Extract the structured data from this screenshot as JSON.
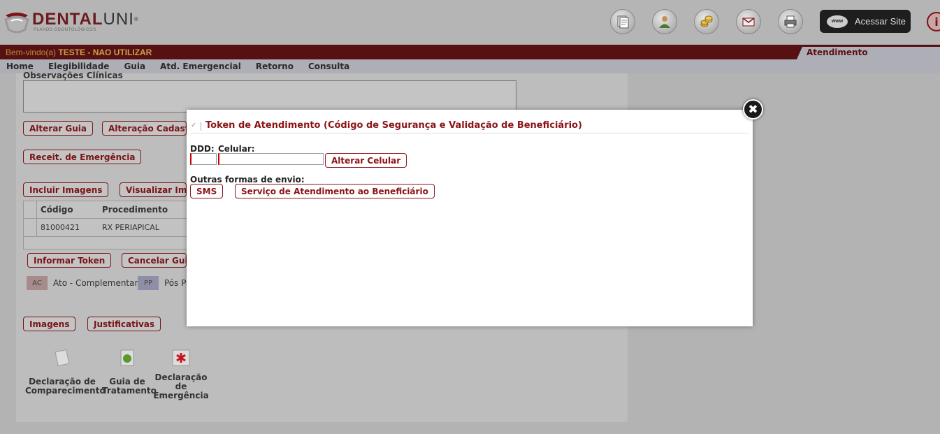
{
  "header": {
    "logo_main": "DENTAL",
    "logo_accent": "UNI",
    "logo_reg": "®",
    "logo_sub": "PLANOS ODONTOLÓGICOS",
    "icons": [
      "documents-icon",
      "user-icon",
      "coins-icon",
      "mail-icon",
      "printer-icon"
    ],
    "www_badge": "www",
    "acessar_site": "Acessar Site",
    "info_glyph": "i"
  },
  "welcome": {
    "prefix": "Bem-vindo(a) ",
    "user": "TESTE - NAO UTILIZAR",
    "section": "Atendimento"
  },
  "menu": {
    "items": [
      "Home",
      "Elegibilidade",
      "Guia",
      "Atd. Emergencial",
      "Retorno",
      "Consulta"
    ]
  },
  "background": {
    "obs_label": "Observações Clínicas",
    "buttons": {
      "alterar_guia": "Alterar Guia",
      "alteracao_cadastral": "Alteração Cadastral",
      "receit_emergencia": "Receit. de Emergência",
      "incluir_imagens": "Incluir Imagens",
      "visualizar_imagens": "Visualizar Imagens",
      "informar_token": "Informar Token",
      "cancelar_guia": "Cancelar Guia",
      "imagens": "Imagens",
      "justificativas": "Justificativas"
    },
    "table": {
      "headers": [
        "Código",
        "Procedimento"
      ],
      "rows": [
        [
          "81000421",
          "RX PERIAPICAL"
        ]
      ]
    },
    "legend": [
      {
        "code": "AC",
        "label": "Ato - Complementar",
        "color": "#a78a8a"
      },
      {
        "code": "PP",
        "label": "Pós Pa",
        "color": "#8e8ea6"
      }
    ],
    "docs": {
      "declaracao_comparecimento": [
        "Declaração de",
        "Comparecimento"
      ],
      "guia_tratamento": [
        "Guia de",
        "Tratamento"
      ],
      "declaracao_emergencia": [
        "Declaração",
        "de",
        "Emergência"
      ]
    }
  },
  "modal": {
    "title": "Token de Atendimento (Código de Segurança e Validação de Beneficiário)",
    "ddd_label": "DDD:",
    "celular_label": "Celular:",
    "ddd_value": "",
    "celular_value": "",
    "alterar_celular": "Alterar Celular",
    "outras_label": "Outras formas de envio:",
    "sms": "SMS",
    "sab": "Serviço de Atendimento ao Beneficiário",
    "close_glyph": "✖"
  },
  "colors": {
    "brand": "#7a1416",
    "welcome_bar": "#571113",
    "menu_bar": "#aeaeb6",
    "overlay": "#b3b3b3"
  }
}
